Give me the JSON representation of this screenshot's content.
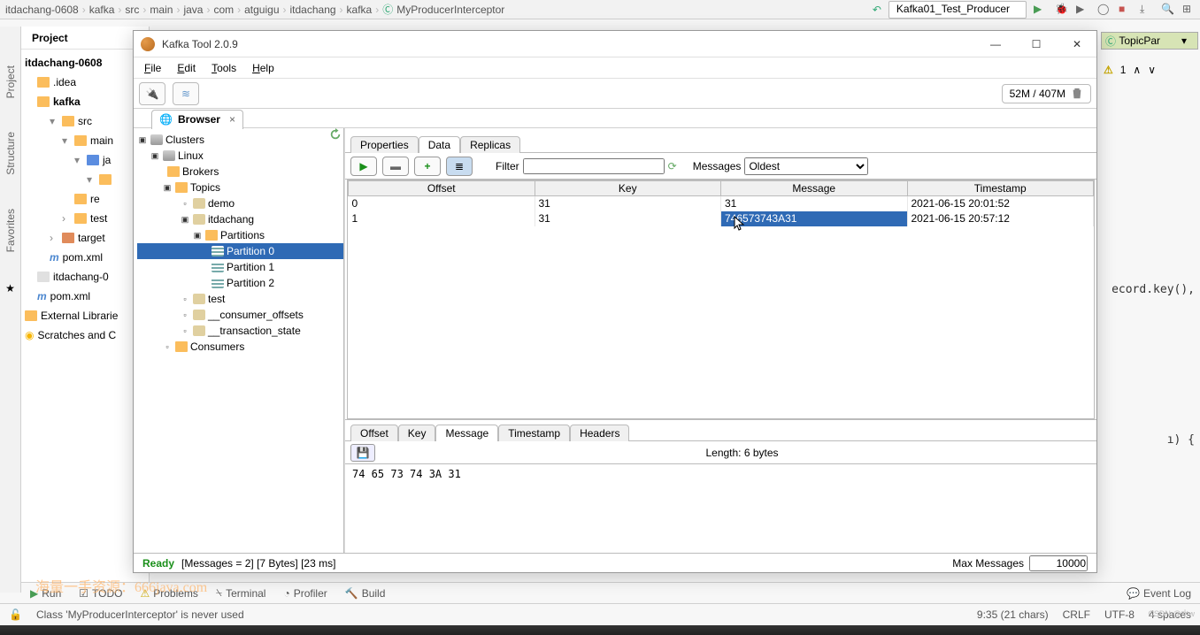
{
  "ide": {
    "breadcrumbs": [
      "itdachang-0608",
      "kafka",
      "src",
      "main",
      "java",
      "com",
      "atguigu",
      "itdachang",
      "kafka",
      "MyProducerInterceptor"
    ],
    "run_combo": "Kafka01_Test_Producer",
    "left_tabs": [
      "Project",
      "Structure",
      "Favorites"
    ],
    "project_label": "Project",
    "tree": {
      "root": "itdachang-0608",
      "idea": ".idea",
      "kafka": "kafka",
      "src": "src",
      "main": "main",
      "ja": "ja",
      "re": "re",
      "test": "test",
      "target": "target",
      "pom_child": "pom.xml",
      "iml": "itdachang-0",
      "pom_root": "pom.xml",
      "ext_lib": "External Librarie",
      "scratches": "Scratches and C"
    },
    "right_tab": "TopicPar",
    "warn_count": "1",
    "code1": "ecord.key(),",
    "code2": "ı) {",
    "bottom": {
      "run": "Run",
      "todo": "TODO",
      "problems": "Problems",
      "terminal": "Terminal",
      "profiler": "Profiler",
      "build": "Build",
      "event_log": "Event Log"
    },
    "status": {
      "msg": "Class 'MyProducerInterceptor' is never used",
      "pos": "9:35 (21 chars)",
      "crlf": "CRLF",
      "enc": "UTF-8",
      "indent": "4 spaces"
    }
  },
  "kafka": {
    "title": "Kafka Tool  2.0.9",
    "menu": {
      "file": "File",
      "edit": "Edit",
      "tools": "Tools",
      "help": "Help"
    },
    "memory": "52M / 407M",
    "browser_tab": "Browser",
    "tree": {
      "clusters": "Clusters",
      "linux": "Linux",
      "brokers": "Brokers",
      "topics": "Topics",
      "demo": "demo",
      "itdachang": "itdachang",
      "partitions": "Partitions",
      "p0": "Partition 0",
      "p1": "Partition 1",
      "p2": "Partition 2",
      "t_test": "test",
      "consumer_off": "__consumer_offsets",
      "tx_state": "__transaction_state",
      "consumers": "Consumers"
    },
    "main_tabs": {
      "properties": "Properties",
      "data": "Data",
      "replicas": "Replicas"
    },
    "filter_label": "Filter",
    "messages_label": "Messages",
    "messages_select": "Oldest",
    "columns": {
      "offset": "Offset",
      "key": "Key",
      "message": "Message",
      "timestamp": "Timestamp"
    },
    "rows": [
      {
        "offset": "0",
        "key": "31",
        "message": "31",
        "timestamp": "2021-06-15 20:01:52"
      },
      {
        "offset": "1",
        "key": "31",
        "message": "746573743A31",
        "timestamp": "2021-06-15 20:57:12"
      }
    ],
    "detail_tabs": {
      "offset": "Offset",
      "key": "Key",
      "message": "Message",
      "timestamp": "Timestamp",
      "headers": "Headers"
    },
    "length_label": "Length: 6 bytes",
    "hex": "74 65 73 74 3A 31",
    "status": {
      "ready": "Ready",
      "summary": "[Messages = 2]  [7 Bytes]  [23 ms]",
      "max_label": "Max Messages",
      "max_value": "10000"
    }
  },
  "watermark": "海量一手资源：666java.com",
  "csdn": "CSDN @水w"
}
